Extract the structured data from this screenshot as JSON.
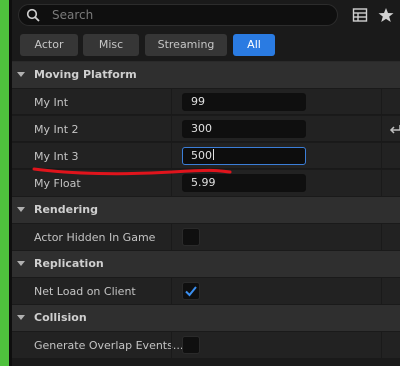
{
  "search": {
    "placeholder": "Search"
  },
  "toolbar": {
    "icons": [
      "table-view-icon",
      "star-icon"
    ]
  },
  "filters": [
    {
      "label": "Actor",
      "active": false
    },
    {
      "label": "Misc",
      "active": false
    },
    {
      "label": "Streaming",
      "active": false
    },
    {
      "label": "All",
      "active": true
    }
  ],
  "categories": {
    "moving_platform": {
      "label": "Moving Platform",
      "props": [
        {
          "label": "My Int",
          "value": "99"
        },
        {
          "label": "My Int 2",
          "value": "300"
        },
        {
          "label": "My Int 3",
          "value": "500"
        },
        {
          "label": "My Float",
          "value": "5.99"
        }
      ]
    },
    "rendering": {
      "label": "Rendering",
      "props": [
        {
          "label": "Actor Hidden In Game",
          "checked": false
        }
      ]
    },
    "replication": {
      "label": "Replication",
      "props": [
        {
          "label": "Net Load on Client",
          "checked": true
        }
      ]
    },
    "collision": {
      "label": "Collision",
      "props": [
        {
          "label": "Generate Overlap Events...",
          "checked": false
        }
      ]
    }
  },
  "colors": {
    "accent": "#2a7be2",
    "side_strip": "#4fc23d",
    "annotation": "#e0141c"
  }
}
